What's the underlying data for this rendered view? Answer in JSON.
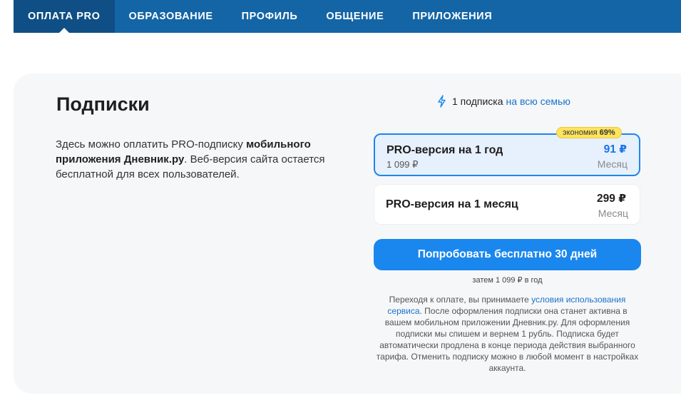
{
  "nav": {
    "items": [
      {
        "label": "ОПЛАТА PRO",
        "active": true
      },
      {
        "label": "ОБРАЗОВАНИЕ",
        "active": false
      },
      {
        "label": "ПРОФИЛЬ",
        "active": false
      },
      {
        "label": "ОБЩЕНИЕ",
        "active": false
      },
      {
        "label": "ПРИЛОЖЕНИЯ",
        "active": false
      }
    ]
  },
  "page": {
    "title": "Подписки",
    "description": {
      "part1": "Здесь можно оплатить PRO-подписку ",
      "bold": "мобильного приложения Дневник.ру",
      "part2": ". Веб-версия сайта остается бесплатной для всех пользователей."
    }
  },
  "family": {
    "icon": "lightning-icon",
    "text": "1 подписка",
    "link": "на всю семью"
  },
  "plans": [
    {
      "name": "PRO-версия на 1 год",
      "old_price": "1 099 ₽",
      "price": "91 ₽",
      "period": "Месяц",
      "selected": true,
      "badge_text": "экономия",
      "badge_value": "69%"
    },
    {
      "name": "PRO-версия на 1 месяц",
      "price": "299 ₽",
      "period": "Месяц",
      "selected": false
    }
  ],
  "cta": {
    "label": "Попробовать бесплатно 30 дней",
    "subtext": "затем 1 099 ₽ в год"
  },
  "legal": {
    "part1": "Переходя к оплате, вы принимаете ",
    "link": "условия использования сервиса",
    "part2": ". После оформления подписки она станет активна в вашем мобильном приложении Дневник.ру. Для оформления подписки мы спишем и вернем 1 рубль. Подписка будет автоматически продлена в конце периода действия выбранного тарифа. Отменить подписку можно в любой момент в настройках аккаунта."
  },
  "colors": {
    "nav_bg": "#1465a6",
    "nav_active_bg": "#0f4f85",
    "accent": "#1a87ee",
    "link": "#1a73c9",
    "badge_bg": "#ffe45e",
    "card_bg": "#f6f7f9"
  }
}
